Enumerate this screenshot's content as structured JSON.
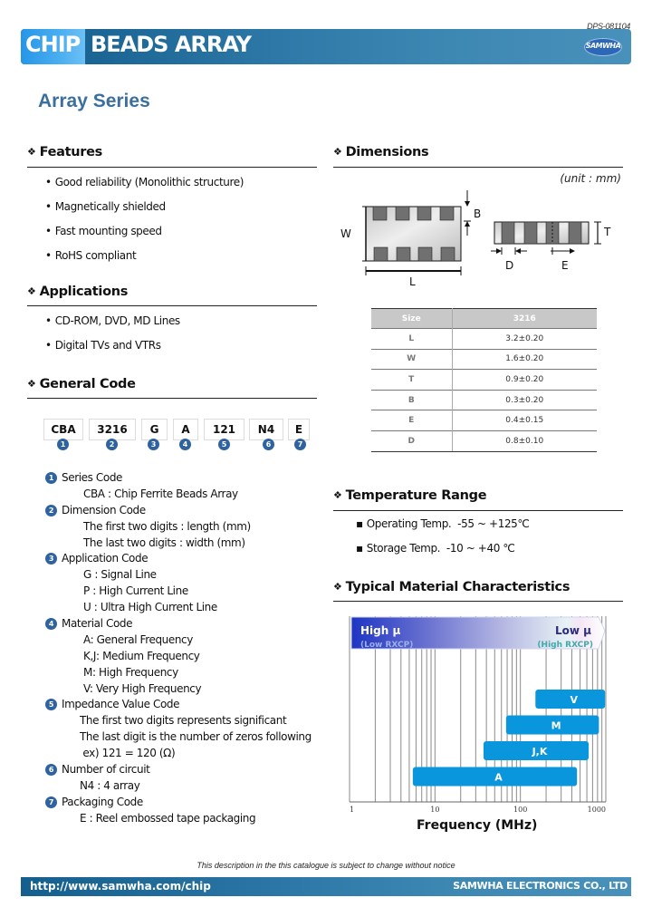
{
  "header": {
    "doc_code": "DPS-081104",
    "title_chip": "CHIP",
    "title": "BEADS ARRAY",
    "logo_text": "SAMWHA"
  },
  "series_title": "Array Series",
  "features": {
    "title": "Features",
    "items": [
      "Good reliability (Monolithic structure)",
      "Magnetically shielded",
      "Fast mounting speed",
      "RoHS compliant"
    ]
  },
  "applications": {
    "title": "Applications",
    "items": [
      "CD-ROM, DVD, MD Lines",
      "Digital TVs and VTRs"
    ]
  },
  "general_code": {
    "title": "General Code",
    "codes": [
      {
        "value": "CBA",
        "num": "1"
      },
      {
        "value": "3216",
        "num": "2"
      },
      {
        "value": "G",
        "num": "3"
      },
      {
        "value": "A",
        "num": "4"
      },
      {
        "value": "121",
        "num": "5"
      },
      {
        "value": "N4",
        "num": "6"
      },
      {
        "value": "E",
        "num": "7"
      }
    ],
    "legend": [
      {
        "num": "1",
        "title": "Series Code",
        "lines": [
          "CBA : Chip Ferrite Beads Array"
        ]
      },
      {
        "num": "2",
        "title": "Dimension Code",
        "lines": [
          "The first two digits : length (mm)",
          "The last two digits : width (mm)"
        ]
      },
      {
        "num": "3",
        "title": "Application Code",
        "lines": [
          "G : Signal Line",
          "P : High Current Line",
          "U : Ultra High Current Line"
        ]
      },
      {
        "num": "4",
        "title": "Material Code",
        "lines": [
          "A: General Frequency",
          "K,J: Medium Frequency",
          "M: High Frequency",
          "V: Very High Frequency"
        ]
      },
      {
        "num": "5",
        "title": "Impedance Value Code",
        "lines": [
          "The first two digits represents significant",
          "The last digit is the number of zeros following",
          " ex) 121 = 120 (Ω)"
        ]
      },
      {
        "num": "6",
        "title": "Number of circuit",
        "lines": [
          "N4 : 4 array"
        ]
      },
      {
        "num": "7",
        "title": "Packaging Code",
        "lines": [
          "E : Reel embossed tape packaging"
        ]
      }
    ]
  },
  "dimensions": {
    "title": "Dimensions",
    "unit_note": "(unit : mm)",
    "labels": {
      "W": "W",
      "L": "L",
      "B": "B",
      "T": "T",
      "D": "D",
      "E": "E"
    },
    "table": {
      "headers": [
        "Size",
        "3216"
      ],
      "rows": [
        [
          "L",
          "3.2±0.20"
        ],
        [
          "W",
          "1.6±0.20"
        ],
        [
          "T",
          "0.9±0.20"
        ],
        [
          "B",
          "0.3±0.20"
        ],
        [
          "E",
          "0.4±0.15"
        ],
        [
          "D",
          "0.8±0.10"
        ]
      ]
    }
  },
  "temperature": {
    "title": "Temperature Range",
    "items": [
      "Operating Temp.  -55 ~ +125℃",
      "Storage Temp.  -10 ~ +40 ℃"
    ]
  },
  "material": {
    "title": "Typical Material Characteristics",
    "high_mu": "High μ",
    "low_rxcp": "(Low RXCP)",
    "low_mu": "Low μ",
    "high_rxcp": "(High RXCP)"
  },
  "chart_data": {
    "type": "bar",
    "orientation": "horizontal-range",
    "title": "Typical Material Characteristics",
    "xlabel": "Frequency (MHz)",
    "ylabel": "",
    "xscale": "log",
    "xlim": [
      1,
      1000
    ],
    "xticks": [
      1,
      10,
      100,
      1000
    ],
    "xtick_labels": [
      "1",
      "10",
      "100",
      "1000"
    ],
    "grid": true,
    "categories": [
      "V",
      "M",
      "J,K",
      "A"
    ],
    "series": [
      {
        "name": "V",
        "start": 150,
        "end": 980
      },
      {
        "name": "M",
        "start": 68,
        "end": 830
      },
      {
        "name": "J,K",
        "start": 37,
        "end": 630
      },
      {
        "name": "A",
        "start": 5.5,
        "end": 460
      }
    ],
    "bar_color": "#0a96dc"
  },
  "footer": {
    "disclaimer": "This description in the this catalogue is subject to change without notice",
    "url": "http://www.samwha.com/chip",
    "company": "SAMWHA ELECTRONICS CO., LTD"
  }
}
